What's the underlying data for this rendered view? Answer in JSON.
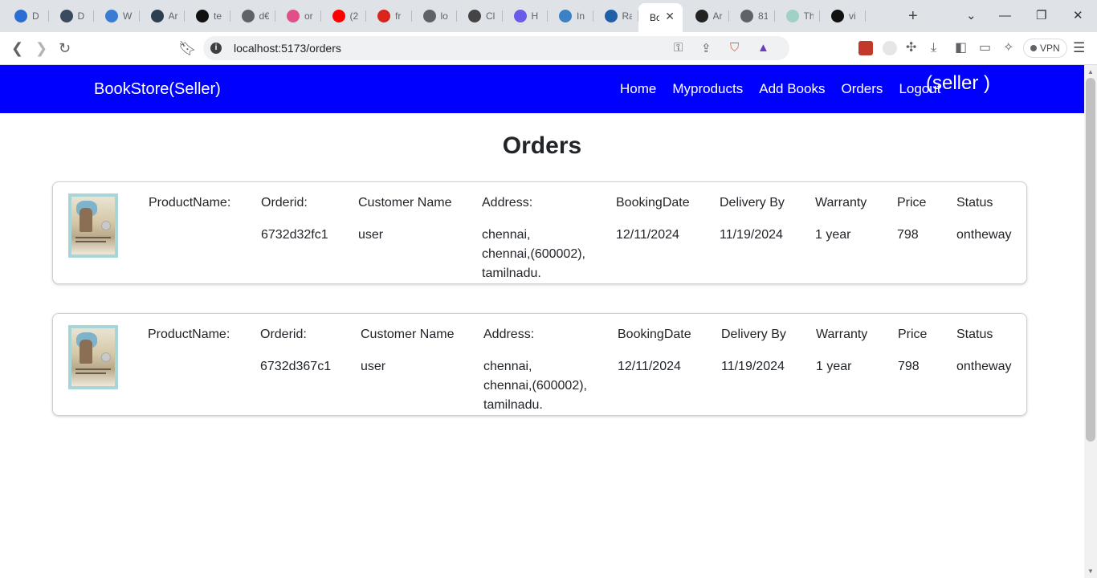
{
  "browser": {
    "tabs": [
      {
        "title": "D",
        "color": "#2b6ed2"
      },
      {
        "title": "D",
        "color": "#3b4a5c"
      },
      {
        "title": "W",
        "color": "#3a7bd5"
      },
      {
        "title": "Ar",
        "color": "#2d3e50"
      },
      {
        "title": "te",
        "color": "#111111"
      },
      {
        "title": "d€",
        "color": "#5f6368"
      },
      {
        "title": "or",
        "color": "#e04f8a"
      },
      {
        "title": "(2",
        "color": "#ff0000"
      },
      {
        "title": "fr",
        "color": "#d9251d"
      },
      {
        "title": "lo",
        "color": "#5f6368"
      },
      {
        "title": "Cl",
        "color": "#444444"
      },
      {
        "title": "H",
        "color": "#6b5ce7"
      },
      {
        "title": "In",
        "color": "#3b82c4"
      },
      {
        "title": "Ra",
        "color": "#1f5fa8"
      },
      {
        "title": "Bo",
        "color": "#ffffff",
        "active": true
      },
      {
        "title": "Ar",
        "color": "#222222"
      },
      {
        "title": "81",
        "color": "#5f6368"
      },
      {
        "title": "Th",
        "color": "#9fd1c8"
      },
      {
        "title": "vi",
        "color": "#111111"
      }
    ],
    "url": "localhost:5173/orders",
    "vpn_label": "VPN"
  },
  "navbar": {
    "brand": "BookStore(Seller)",
    "links": [
      "Home",
      "Myproducts",
      "Add Books",
      "Orders",
      "Logout"
    ],
    "seller_tag": "(seller )"
  },
  "page": {
    "heading": "Orders"
  },
  "labels": {
    "product_name": "ProductName:",
    "order_id": "Orderid:",
    "customer_name": "Customer Name",
    "address": "Address:",
    "booking_date": "BookingDate",
    "delivery_by": "Delivery By",
    "warranty": "Warranty",
    "price": "Price",
    "status": "Status"
  },
  "orders": [
    {
      "product_name": "",
      "order_id": "6732d32fc1",
      "customer_name": "user",
      "address_line1": "chennai,",
      "address_line2": "chennai,(600002),",
      "address_line3": "tamilnadu.",
      "booking_date": "12/11/2024",
      "delivery_by": "11/19/2024",
      "warranty": "1 year",
      "price": "798",
      "status": "ontheway"
    },
    {
      "product_name": "",
      "order_id": "6732d367c1",
      "customer_name": "user",
      "address_line1": "chennai,",
      "address_line2": "chennai,(600002),",
      "address_line3": "tamilnadu.",
      "booking_date": "12/11/2024",
      "delivery_by": "11/19/2024",
      "warranty": "1 year",
      "price": "798",
      "status": "ontheway"
    }
  ]
}
